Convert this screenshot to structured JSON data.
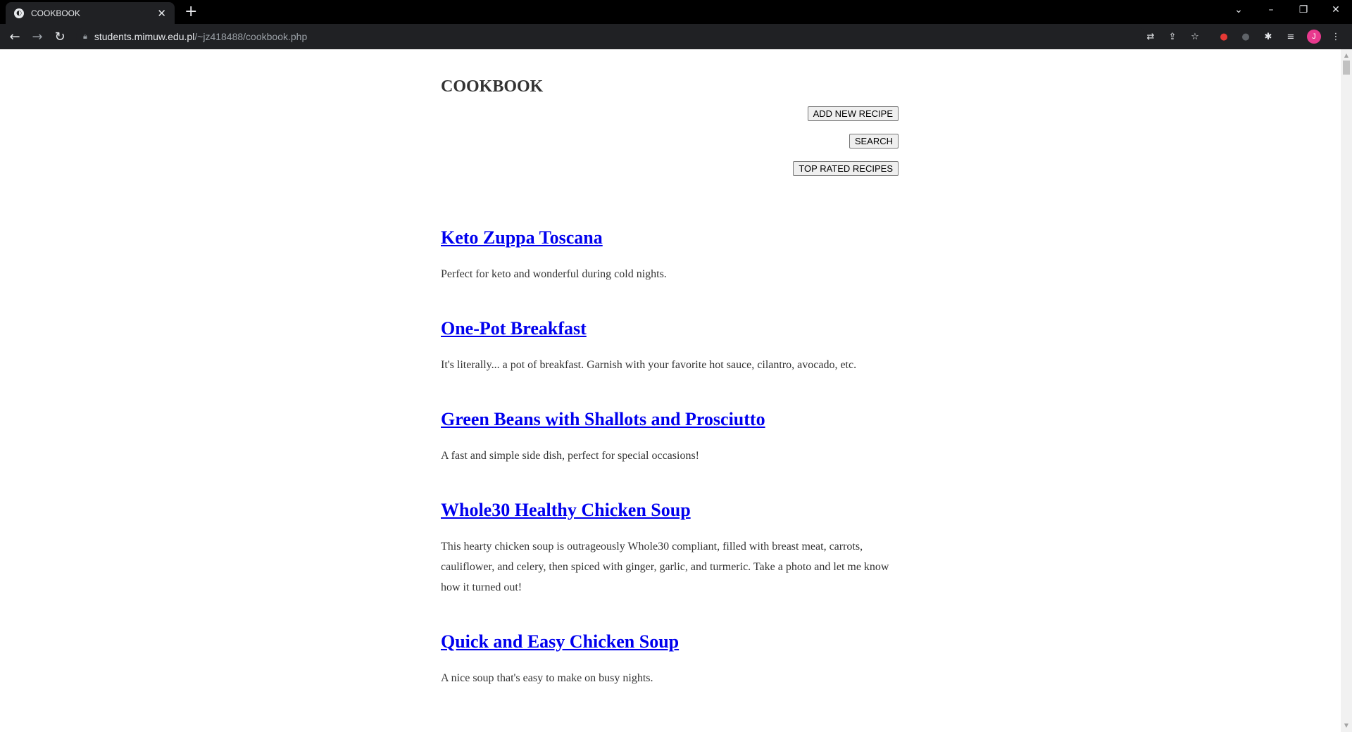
{
  "browser": {
    "tab_title": "COOKBOOK",
    "url_host": "students.mimuw.edu.pl",
    "url_path": "/~jz418488/cookbook.php",
    "avatar_initial": "J"
  },
  "page": {
    "title": "COOKBOOK",
    "buttons": {
      "add_new": "ADD NEW RECIPE",
      "search": "SEARCH",
      "top_rated": "TOP RATED RECIPES"
    },
    "recipes": [
      {
        "name": "Keto Zuppa Toscana",
        "description": "Perfect for keto and wonderful during cold nights."
      },
      {
        "name": "One-Pot Breakfast",
        "description": "It's literally... a pot of breakfast. Garnish with your favorite hot sauce, cilantro, avocado, etc."
      },
      {
        "name": "Green Beans with Shallots and Prosciutto",
        "description": "A fast and simple side dish, perfect for special occasions!"
      },
      {
        "name": "Whole30 Healthy Chicken Soup",
        "description": "This hearty chicken soup is outrageously Whole30 compliant, filled with breast meat, carrots, cauliflower, and celery, then spiced with ginger, garlic, and turmeric. Take a photo and let me know how it turned out!"
      },
      {
        "name": "Quick and Easy Chicken Soup",
        "description": "A nice soup that's easy to make on busy nights."
      }
    ]
  }
}
